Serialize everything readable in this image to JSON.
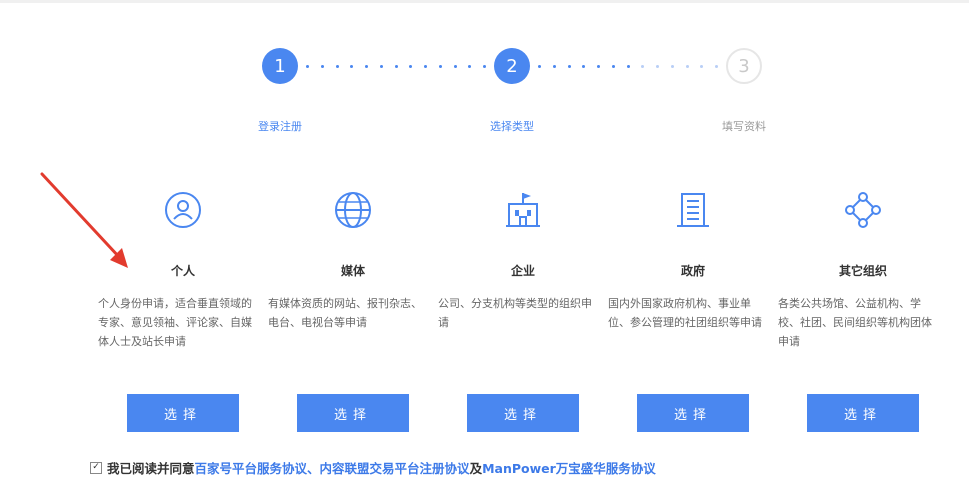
{
  "stepper": {
    "steps": [
      {
        "number": "1",
        "label": "登录注册",
        "state": "done"
      },
      {
        "number": "2",
        "label": "选择类型",
        "state": "current"
      },
      {
        "number": "3",
        "label": "填写资料",
        "state": "pending"
      }
    ]
  },
  "cards": [
    {
      "icon": "person-icon",
      "title": "个人",
      "description": "个人身份申请，适合垂直领域的专家、意见领袖、评论家、自媒体人士及站长申请",
      "button_label": "选择"
    },
    {
      "icon": "globe-icon",
      "title": "媒体",
      "description": "有媒体资质的网站、报刊杂志、电台、电视台等申请",
      "button_label": "选择"
    },
    {
      "icon": "building-flag-icon",
      "title": "企业",
      "description": "公司、分支机构等类型的组织申请",
      "button_label": "选择"
    },
    {
      "icon": "office-building-icon",
      "title": "政府",
      "description": "国内外国家政府机构、事业单位、参公管理的社团组织等申请",
      "button_label": "选择"
    },
    {
      "icon": "network-nodes-icon",
      "title": "其它组织",
      "description": "各类公共场馆、公益机构、学校、社团、民间组织等机构团体申请",
      "button_label": "选择"
    }
  ],
  "agreement": {
    "checked": true,
    "prefix": "我已阅读并同意",
    "link1": "百家号平台服务协议",
    "separator": "、",
    "link2": "内容联盟交易平台注册协议",
    "conjunction": " 及",
    "link3": "ManPower万宝盛华服务协议"
  },
  "colors": {
    "accent": "#4a87f0",
    "annotation_arrow": "#e23b2e"
  }
}
